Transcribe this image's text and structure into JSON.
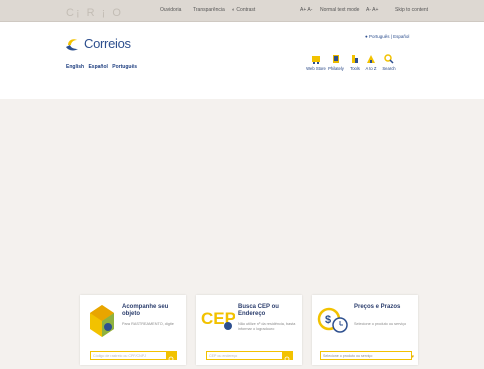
{
  "topbar": {
    "brand_ghost": "C¡ R ¡ O",
    "links": [
      "Ouvidoria",
      "Transparência",
      "Contrast",
      "A+  A-",
      "Normal text mode",
      "A-  A+",
      "Skip to content"
    ]
  },
  "header": {
    "logo_text": "Correios",
    "languages": [
      "English",
      "Español",
      "Português"
    ],
    "lang_switch": "Português  |  Español",
    "tools": [
      {
        "label": "Web Store",
        "icon": "store-icon"
      },
      {
        "label": "Philately",
        "icon": "stamp-icon"
      },
      {
        "label": "Tools",
        "icon": "tools-icon"
      },
      {
        "label": "A to Z",
        "icon": "a-to-z-icon"
      },
      {
        "label": "Search",
        "icon": "search-icon"
      }
    ]
  },
  "cards": [
    {
      "title": "Acompanhe seu objeto",
      "desc": "Para RASTREAMENTO, digite",
      "placeholder": "Código de rastreio ou CPF/CNPJ",
      "icon": "tracking-icon"
    },
    {
      "title": "Busca CEP ou Endereço",
      "desc": "Não utilize nº da residência, basta informar o logradouro",
      "placeholder": "CEP ou endereço",
      "icon": "cep-icon"
    },
    {
      "title": "Preços e Prazos",
      "desc": "Selecione o produto ou serviço",
      "select_value": "Selecione o produto ou serviço",
      "icon": "prices-icon"
    }
  ],
  "colors": {
    "brand_blue": "#2d4f8e",
    "brand_yellow": "#f2c200",
    "background": "#f4f1ee"
  }
}
